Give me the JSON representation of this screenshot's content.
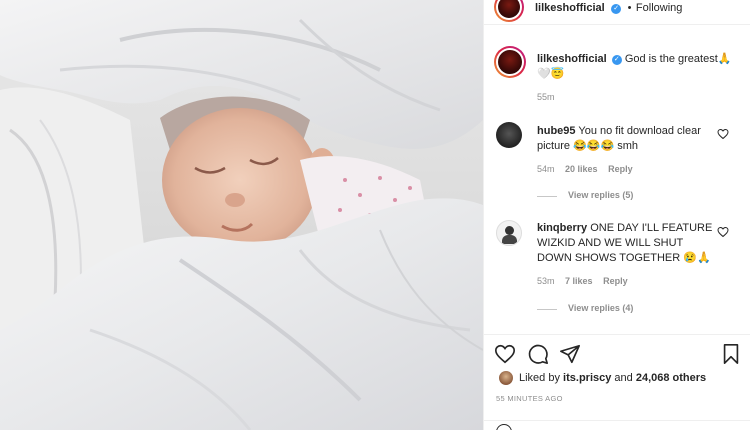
{
  "post": {
    "author": "lilkeshofficial",
    "follow_status": "Following",
    "separator": "•"
  },
  "caption": {
    "author": "lilkeshofficial",
    "text": "God is the greatest🙏",
    "emojis": "🤍😇",
    "time": "55m"
  },
  "comments": [
    {
      "user": "hube95",
      "text": "You no fit download clear picture 😂😂😂 smh",
      "time": "54m",
      "likes": "20 likes",
      "reply": "Reply",
      "view_replies": "View replies (5)"
    },
    {
      "user": "kinqberry",
      "text": "ONE DAY I'LL FEATURE WIZKID AND WE WILL SHUT DOWN SHOWS TOGETHER 😢🙏",
      "time": "53m",
      "likes": "7 likes",
      "reply": "Reply",
      "view_replies": "View replies (4)"
    }
  ],
  "likes": {
    "prefix": "Liked by",
    "user": "its.priscy",
    "middle": "and",
    "count": "24,068 others"
  },
  "timestamp": "55 MINUTES AGO",
  "icons": {
    "like": "heart-icon",
    "comment": "comment-icon",
    "share": "share-icon",
    "save": "bookmark-icon",
    "verified": "verified-badge-icon"
  },
  "colors": {
    "verified": "#3897f0",
    "meta_text": "#8e8e8e",
    "text": "#262626"
  }
}
